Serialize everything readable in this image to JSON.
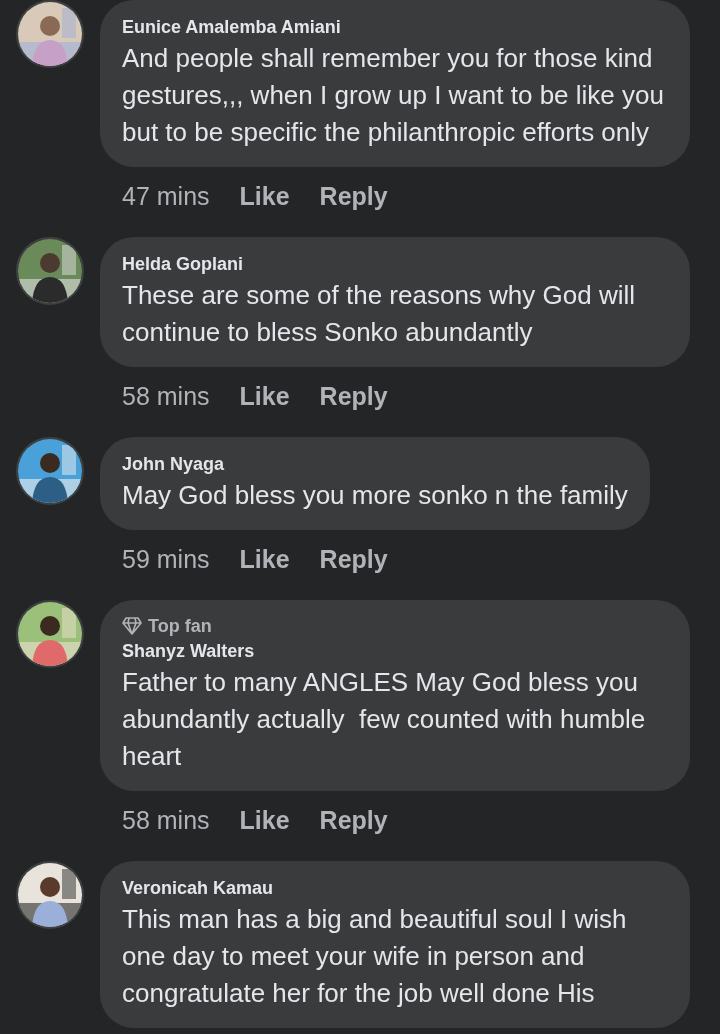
{
  "comments": [
    {
      "name": "Eunice Amalemba Amiani",
      "text": "And people shall remember you for those kind gestures,,, when I grow up I want to be like you but to be specific the philanthropic efforts only",
      "time": "47 mins",
      "actions": [
        "Like",
        "Reply"
      ]
    },
    {
      "name": "Helda Goplani",
      "text": "These are some of the reasons why God will continue to bless Sonko abundantly",
      "time": "58 mins",
      "actions": [
        "Like",
        "Reply"
      ]
    },
    {
      "name": "John Nyaga",
      "text": "May God bless you more sonko n the family",
      "time": "59 mins",
      "actions": [
        "Like",
        "Reply"
      ]
    },
    {
      "badge": "Top fan",
      "name": "Shanyz Walters",
      "text": "Father to many ANGLES May God bless you abundantly actually  few counted with humble heart",
      "time": "58 mins",
      "actions": [
        "Like",
        "Reply"
      ]
    },
    {
      "name": "Veronicah Kamau",
      "text": "This man has a big and beautiful soul I wish one day to meet your wife in person and congratulate her for the job well done His"
    }
  ]
}
